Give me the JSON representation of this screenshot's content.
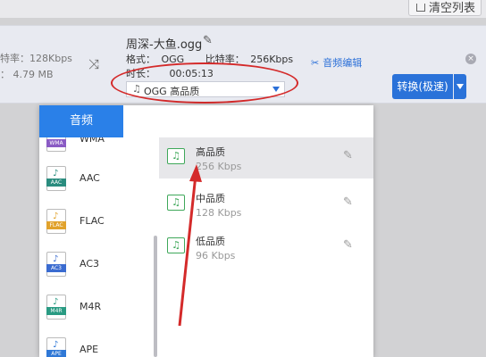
{
  "toolbar": {
    "clear_label": "清空列表"
  },
  "source": {
    "bitrate": "特率：128Kbps",
    "size": "：    4.79 MB"
  },
  "output": {
    "file_name": "周深-大鱼.ogg",
    "format_label": "格式：",
    "format_value": "OGG",
    "bitrate_label": "比特率：",
    "bitrate_value": "256Kbps",
    "duration_label": "时长：",
    "duration_value": "00:05:13",
    "format_select": "OGG  高品质"
  },
  "audio_edit_label": "音频编辑",
  "convert": {
    "label": "转换(极速)"
  },
  "close_glyph": "×",
  "popup": {
    "tab_label": "音频",
    "formats": [
      {
        "name": "WMA",
        "color": "#8a5bc4"
      },
      {
        "name": "AAC",
        "color": "#2a8c7e"
      },
      {
        "name": "FLAC",
        "color": "#e1a22c"
      },
      {
        "name": "AC3",
        "color": "#3a6bd0"
      },
      {
        "name": "M4R",
        "color": "#2a9b83"
      },
      {
        "name": "APE",
        "color": "#2f78d6"
      }
    ],
    "qualities": [
      {
        "name": "高品质",
        "rate": "256 Kbps"
      },
      {
        "name": "中品质",
        "rate": "128 Kbps"
      },
      {
        "name": "低品质",
        "rate": "96 Kbps"
      }
    ]
  },
  "colors": {
    "accent": "#2a72d9",
    "annotation": "#d42a2a",
    "music_icon": "#3fa85a"
  }
}
